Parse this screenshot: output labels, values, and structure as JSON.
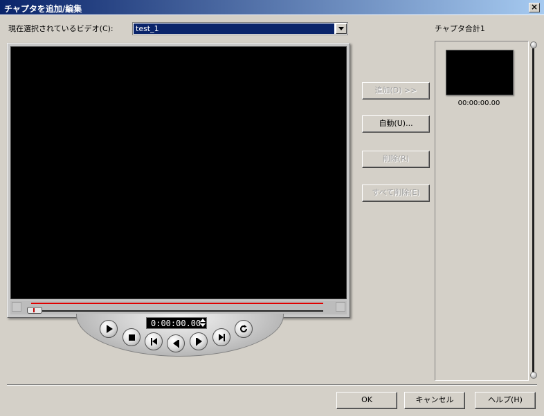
{
  "window": {
    "title": "チャプタを追加/編集",
    "close_label": "×"
  },
  "video": {
    "label": "現在選択されているビデオ(C):",
    "selected": "test_1"
  },
  "chapters": {
    "count_label": "チャプタ合計1",
    "items": [
      {
        "time": "00:00:00.00"
      }
    ]
  },
  "player": {
    "timecode": "0:00:00.00"
  },
  "actions": {
    "add": "追加(D) >>",
    "auto": "自動(U)...",
    "delete": "削除(R)",
    "delete_all": "すべて削除(E)"
  },
  "footer": {
    "ok": "OK",
    "cancel": "キャンセル",
    "help": "ヘルプ(H)"
  }
}
